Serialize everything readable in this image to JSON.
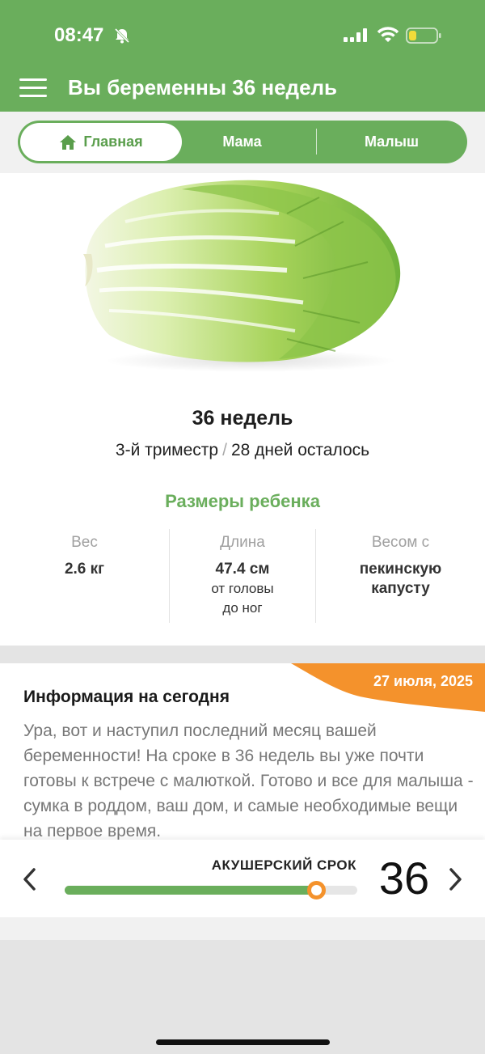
{
  "status_bar": {
    "time": "08:47",
    "icons": [
      "bell-muted-icon",
      "signal-icon",
      "wifi-icon",
      "battery-icon"
    ]
  },
  "app_bar": {
    "title": "Вы беременны 36 недель",
    "menu_icon": "hamburger-menu-icon"
  },
  "tabs": {
    "items": [
      {
        "label": "Главная",
        "icon": "home-icon",
        "active": true
      },
      {
        "label": "Мама",
        "active": false
      },
      {
        "label": "Малыш",
        "active": false
      }
    ]
  },
  "hero": {
    "image": "chinese-cabbage-image",
    "week_title": "36 недель",
    "trimester": "3-й триместр",
    "separator": "/",
    "days_left": "28 дней осталось"
  },
  "sizes": {
    "title": "Размеры ребенка",
    "weight": {
      "label": "Вес",
      "value": "2.6 кг"
    },
    "length": {
      "label": "Длина",
      "value": "47.4 см",
      "sub_1": "от головы",
      "sub_2": "до ног"
    },
    "fruit": {
      "label": "Весом с",
      "value_1": "пекинскую",
      "value_2": "капусту"
    }
  },
  "info": {
    "date": "27 июля, 2025",
    "title": "Информация на сегодня",
    "text": "Ура, вот и наступил последний месяц вашей беременности! На сроке в 36 недель вы уже почти готовы к встрече с малюткой. Готово и все для малыша - сумка в роддом, ваш дом, и самые необходимые вещи на первое время."
  },
  "term": {
    "label": "АКУШЕРСКИЙ СРОК",
    "week": "36",
    "progress_fraction": 0.86
  },
  "colors": {
    "brand_green": "#6aae5c",
    "accent_orange": "#f4922c"
  }
}
